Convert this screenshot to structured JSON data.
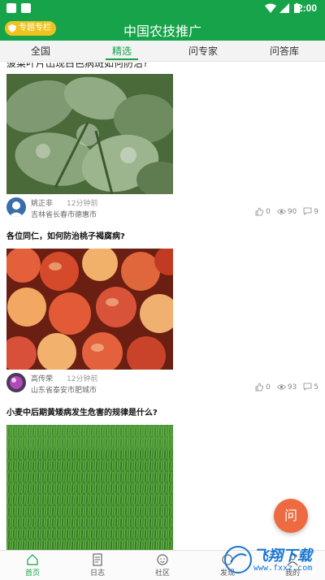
{
  "status_bar": {
    "time": "2:00"
  },
  "header": {
    "title": "中国农技推广",
    "special_button": "专题专栏"
  },
  "tabs": [
    {
      "label": "全国"
    },
    {
      "label": "精选"
    },
    {
      "label": "问专家"
    },
    {
      "label": "问答库"
    }
  ],
  "feed": {
    "clipped_title": "菠菜叶片出现白色病斑如何防治?",
    "posts": [
      {
        "title": "",
        "author": "姚正非",
        "time": "12分钟前",
        "location": "吉林省长春市德惠市",
        "likes": "0",
        "views": "90",
        "comments": "9"
      },
      {
        "title": "各位同仁，如何防治桃子褐腐病?",
        "author": "高传荣",
        "time": "12分钟前",
        "location": "山东省泰安市肥城市",
        "likes": "0",
        "views": "93",
        "comments": "5"
      },
      {
        "title": "小麦中后期黄矮病发生危害的规律是什么?",
        "author": "",
        "time": "",
        "location": "",
        "likes": "",
        "views": "",
        "comments": ""
      }
    ]
  },
  "fab": {
    "label": "问"
  },
  "bottom_nav": [
    {
      "label": "首页",
      "icon": "home-icon"
    },
    {
      "label": "日志",
      "icon": "log-icon"
    },
    {
      "label": "社区",
      "icon": "community-icon"
    },
    {
      "label": "发现",
      "icon": "discover-icon"
    },
    {
      "label": "我的",
      "icon": "profile-icon"
    }
  ],
  "watermark": {
    "text": "飞翔下载",
    "sub": "www.fxxz.com"
  },
  "colors": {
    "primary": "#16a34a",
    "accent": "#f0c21f",
    "fab": "#ee6a40"
  }
}
